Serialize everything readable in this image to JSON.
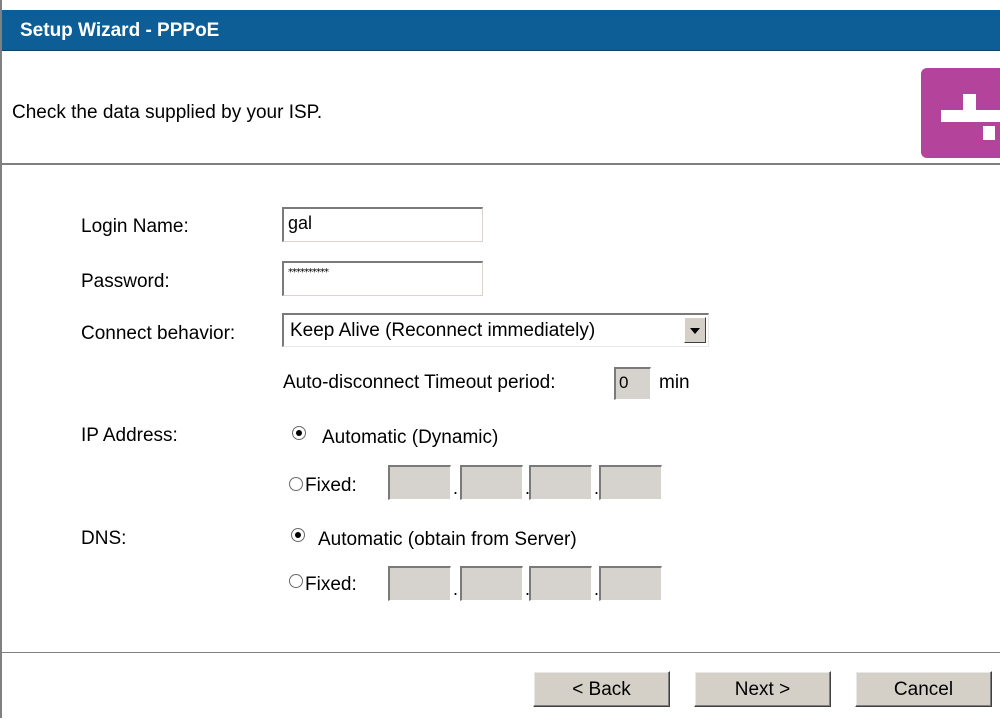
{
  "window": {
    "title": "Setup Wizard - PPPoE",
    "instruction": "Check the data supplied by your ISP."
  },
  "form": {
    "login_name": {
      "label": "Login Name:",
      "value": "gal"
    },
    "password": {
      "label": "Password:",
      "value": "**********"
    },
    "connect_behavior": {
      "label": "Connect behavior:",
      "value": "Keep Alive (Reconnect immediately)"
    },
    "timeout": {
      "label": "Auto-disconnect Timeout period:",
      "value": "0",
      "unit": "min"
    },
    "ip_address": {
      "label": "IP Address:",
      "automatic_label": "Automatic (Dynamic)",
      "fixed_label": "Fixed:",
      "selected": "automatic",
      "octets": [
        "",
        "",
        "",
        ""
      ]
    },
    "dns": {
      "label": "DNS:",
      "automatic_label": "Automatic (obtain from Server)",
      "fixed_label": "Fixed:",
      "selected": "automatic",
      "octets": [
        "",
        "",
        "",
        ""
      ]
    },
    "octet_separator": "."
  },
  "buttons": {
    "back": "< Back",
    "next": "Next >",
    "cancel": "Cancel"
  },
  "colors": {
    "title_bar": "#0d5e96",
    "logo_bg": "#b4439b"
  }
}
